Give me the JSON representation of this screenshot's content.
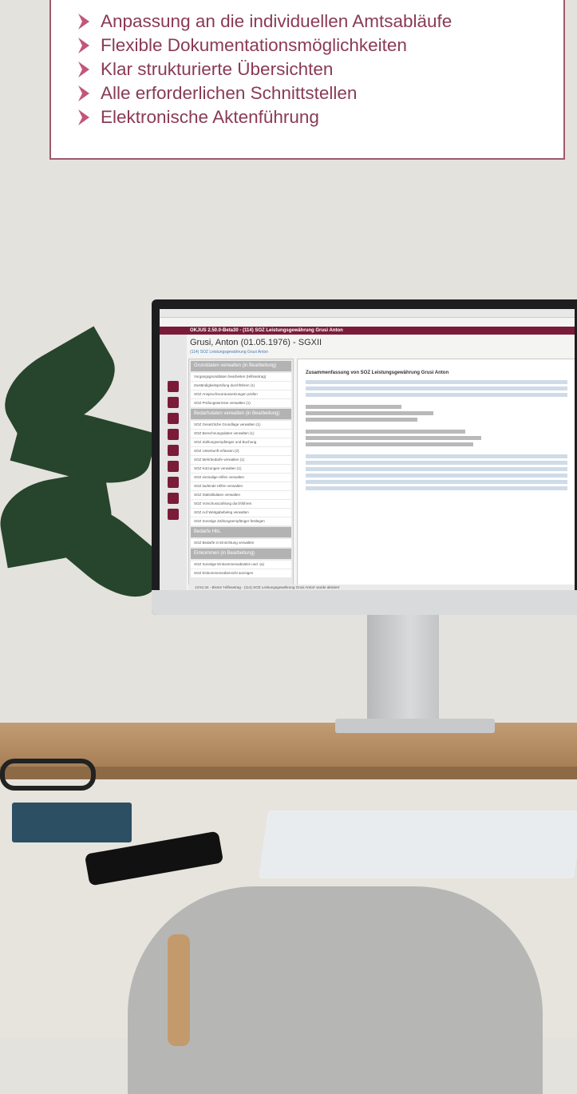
{
  "features": {
    "items": [
      "Anpassung an die individuellen Amtsabläufe",
      "Flexible Dokumentationsmöglichkeiten",
      "Klar strukturierte Übersichten",
      "Alle erforderlichen Schnittstellen",
      "Elektronische Aktenführung"
    ],
    "bullet_color": "#c2567a",
    "text_color": "#8a3a56",
    "border_color": "#a05a6c"
  },
  "screen": {
    "title": "OKJUS 2.50.0-Beta30 - (114) SOZ Leistungsgewährung Grusi Anton",
    "heading": "Grusi, Anton (01.05.1976) - SGXII",
    "breadcrumb": "(114) SOZ Leistungsgewährung Grusi Anton",
    "left_sections": [
      {
        "label": "Grunddaten verwalten (in Bearbeitung)",
        "rows": [
          "Vorgangsgrunddaten bearbeiten (Hilfeantrag)",
          "Zuständigkeitsprüfung durchführen (1)",
          "SOZ Anspruchsvoraussetzungen prüfen",
          "SOZ Prüfungstermine verwalten (1)"
        ]
      },
      {
        "label": "Bedarfsdaten verwalten (in Bearbeitung)",
        "rows": [
          "SOZ Gesetzliche Grundlage verwalten (1)",
          "SOZ Berechnungsdaten verwalten (1)",
          "SOZ Zahlungsempfänger und Buchung",
          "SOZ Unterkunft erfassen (2)",
          "SOZ Mehrbedarfe verwalten (1)",
          "SOZ Kürzungen verwalten (1)",
          "SOZ einmalige Hilfen verwalten",
          "SOZ laufende Hilfen verwalten",
          "SOZ Statistikdaten verwalten",
          "SOZ Vorschusszahlung durchführen",
          "SOZ Auf Weitgabebeleg verwalten",
          "SOZ Sonstige Zahlungsempfänger festlegen"
        ]
      },
      {
        "label": "Bedarfe HbL",
        "rows": [
          "SOZ Bedarfe in Einrichtung verwalten"
        ]
      },
      {
        "label": "Einkommen (in Bearbeitung)",
        "rows": [
          "SOZ Sonstige Einkommensabsätze und -(a)",
          "SOZ Einkommensübersicht anzeigen"
        ]
      }
    ],
    "right_heading": "Zusammenfassung von SOZ Leistungsgewährung Grusi Anton",
    "status": "13:51:34 - Bisme 'Hilfeantrag - (114) SOZ Leistungsgewährung Grusi Anton' wurde aktiviert"
  }
}
